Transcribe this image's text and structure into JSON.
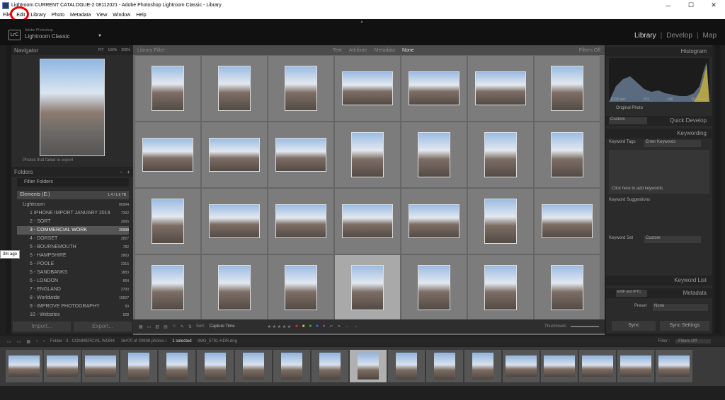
{
  "window": {
    "title": "Lightroom CURRENT CATALOGUE-2 08112021 - Adobe Photoshop Lightroom Classic - Library",
    "controls": [
      "─",
      "☐",
      "✕"
    ]
  },
  "menubar": [
    "File",
    "Edit",
    "Library",
    "Photo",
    "Metadata",
    "View",
    "Window",
    "Help"
  ],
  "identity": {
    "logo": "LrC",
    "small": "Adobe Photoshop",
    "product": "Lightroom Classic"
  },
  "modules": {
    "library": "Library",
    "develop": "Develop",
    "map": "Map",
    "sep": "|"
  },
  "navigator": {
    "title": "Navigator",
    "options": [
      "FIT",
      "100%",
      "200%"
    ],
    "caption": "Photos that failed to export"
  },
  "folders": {
    "title": "Folders",
    "filter": "Filter Folders",
    "volume": {
      "name": "Elements (E:)",
      "info": "1.4 / 1.6 TB"
    },
    "root": {
      "name": "Lightroom",
      "count": "80994"
    },
    "items": [
      {
        "name": "1 IPHONE IMPORT JANUARY 2019",
        "count": "7392"
      },
      {
        "name": "2 - SORT",
        "count": "2065"
      },
      {
        "name": "3 - COMMERCIAL WORK",
        "count": "20998"
      },
      {
        "name": "4 - DORSET",
        "count": "2827"
      },
      {
        "name": "5 - BOURNEMOUTH",
        "count": "782"
      },
      {
        "name": "5 - HAMPSHIRE",
        "count": "2863"
      },
      {
        "name": "5 - POOLE",
        "count": "2315"
      },
      {
        "name": "5 - SANDBANKS",
        "count": "1883"
      },
      {
        "name": "6 - LONDON",
        "count": "664"
      },
      {
        "name": "7 - ENGLAND",
        "count": "2700"
      },
      {
        "name": "8 - Worldwide",
        "count": "15607"
      },
      {
        "name": "9 - IMPROVE PHOTOGRAPHY",
        "count": "50"
      },
      {
        "name": "10 - Websites",
        "count": "628"
      }
    ]
  },
  "left_buttons": {
    "import": "Import...",
    "export": "Export..."
  },
  "library_filter": {
    "label": "Library Filter :",
    "text": "Text",
    "attribute": "Attribute",
    "metadata": "Metadata",
    "none": "None",
    "filters": "Filters Off"
  },
  "toolbar": {
    "sort_label": "Sort:",
    "sort_value": "Capture Time",
    "thumbnails": "Thumbnails"
  },
  "right_panel": {
    "histogram": "Histogram",
    "histo_info": [
      "1/320 sec",
      "f/11",
      "100",
      "11/100 sec"
    ],
    "original": "Original Photo",
    "quick_develop": "Quick Develop",
    "custom": "Custom",
    "keywording": "Keywording",
    "keyword_tags": "Keyword Tags",
    "enter_keywords": "Enter Keywords",
    "click_here": "Click here to add keywords",
    "keyword_suggestions": "Keyword Suggestions",
    "keyword_set": "Keyword Set",
    "keyword_list": "Keyword List",
    "metadata": "Metadata",
    "default": "EXIF and IPTC",
    "preset_label": "Preset",
    "preset_value": "None",
    "sync_metadata": "Sync",
    "sync_settings": "Sync Settings"
  },
  "filmstrip_bar": {
    "folder": "Folder : 3 - COMMERCIAL WORK",
    "count": "16470 of 20998 photos /",
    "selected": "1 selected",
    "file": "/IMG_5791-HDR.dng",
    "filter_label": "Filter :",
    "filter_value": "Filters Off"
  },
  "tooltip": "3m ago"
}
